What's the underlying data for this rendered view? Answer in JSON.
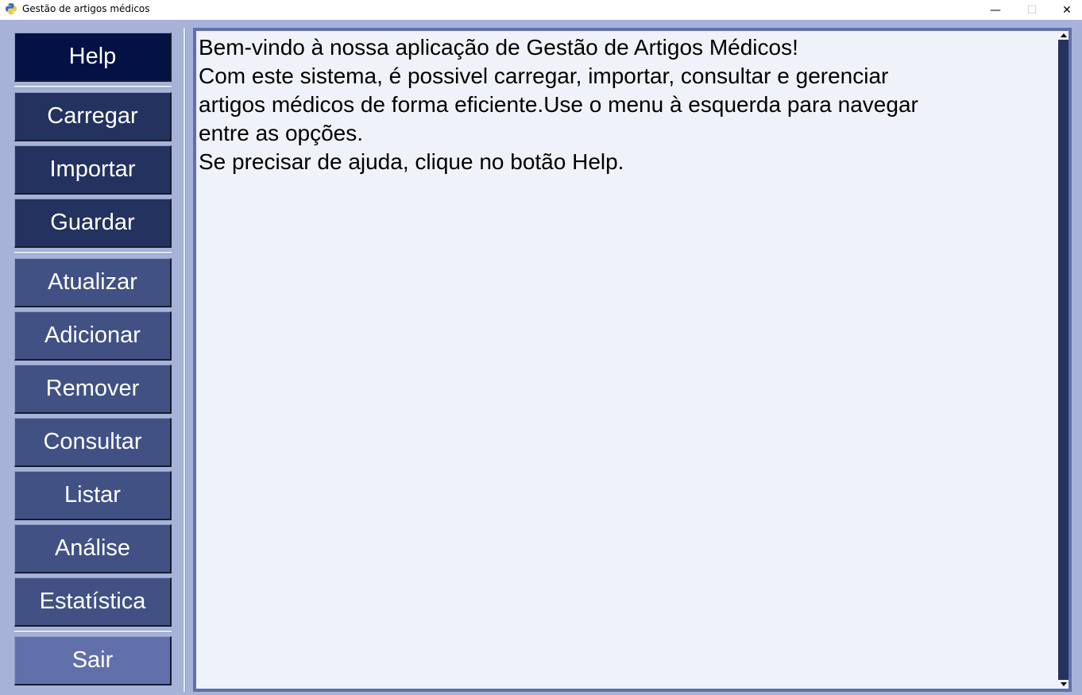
{
  "window": {
    "title": "Gestão de artigos médicos",
    "controls": {
      "minimize": "—",
      "maximize": "☐",
      "close": "✕"
    }
  },
  "menu": {
    "help": "Help",
    "file_group": [
      "Carregar",
      "Importar",
      "Guardar"
    ],
    "ops_group": [
      "Atualizar",
      "Adicionar",
      "Remover",
      "Consultar",
      "Listar",
      "Análise",
      "Estatística"
    ],
    "exit": "Sair"
  },
  "content": {
    "lines": [
      "Bem-vindo à nossa aplicação de Gestão de Artigos Médicos!",
      "Com este sistema, é possivel carregar, importar, consultar e gerenciar",
      "artigos médicos de forma eficiente.Use o menu à esquerda para navegar",
      "entre as opções.",
      "Se precisar de ajuda, clique no botão Help."
    ]
  },
  "colors": {
    "background": "#a6b2d8",
    "help_button": "#031144",
    "file_buttons": "#23325f",
    "ops_buttons": "#415184",
    "exit_button": "#6170aa",
    "text_area": "#eff2f8",
    "scrollbar": "#23325f"
  }
}
